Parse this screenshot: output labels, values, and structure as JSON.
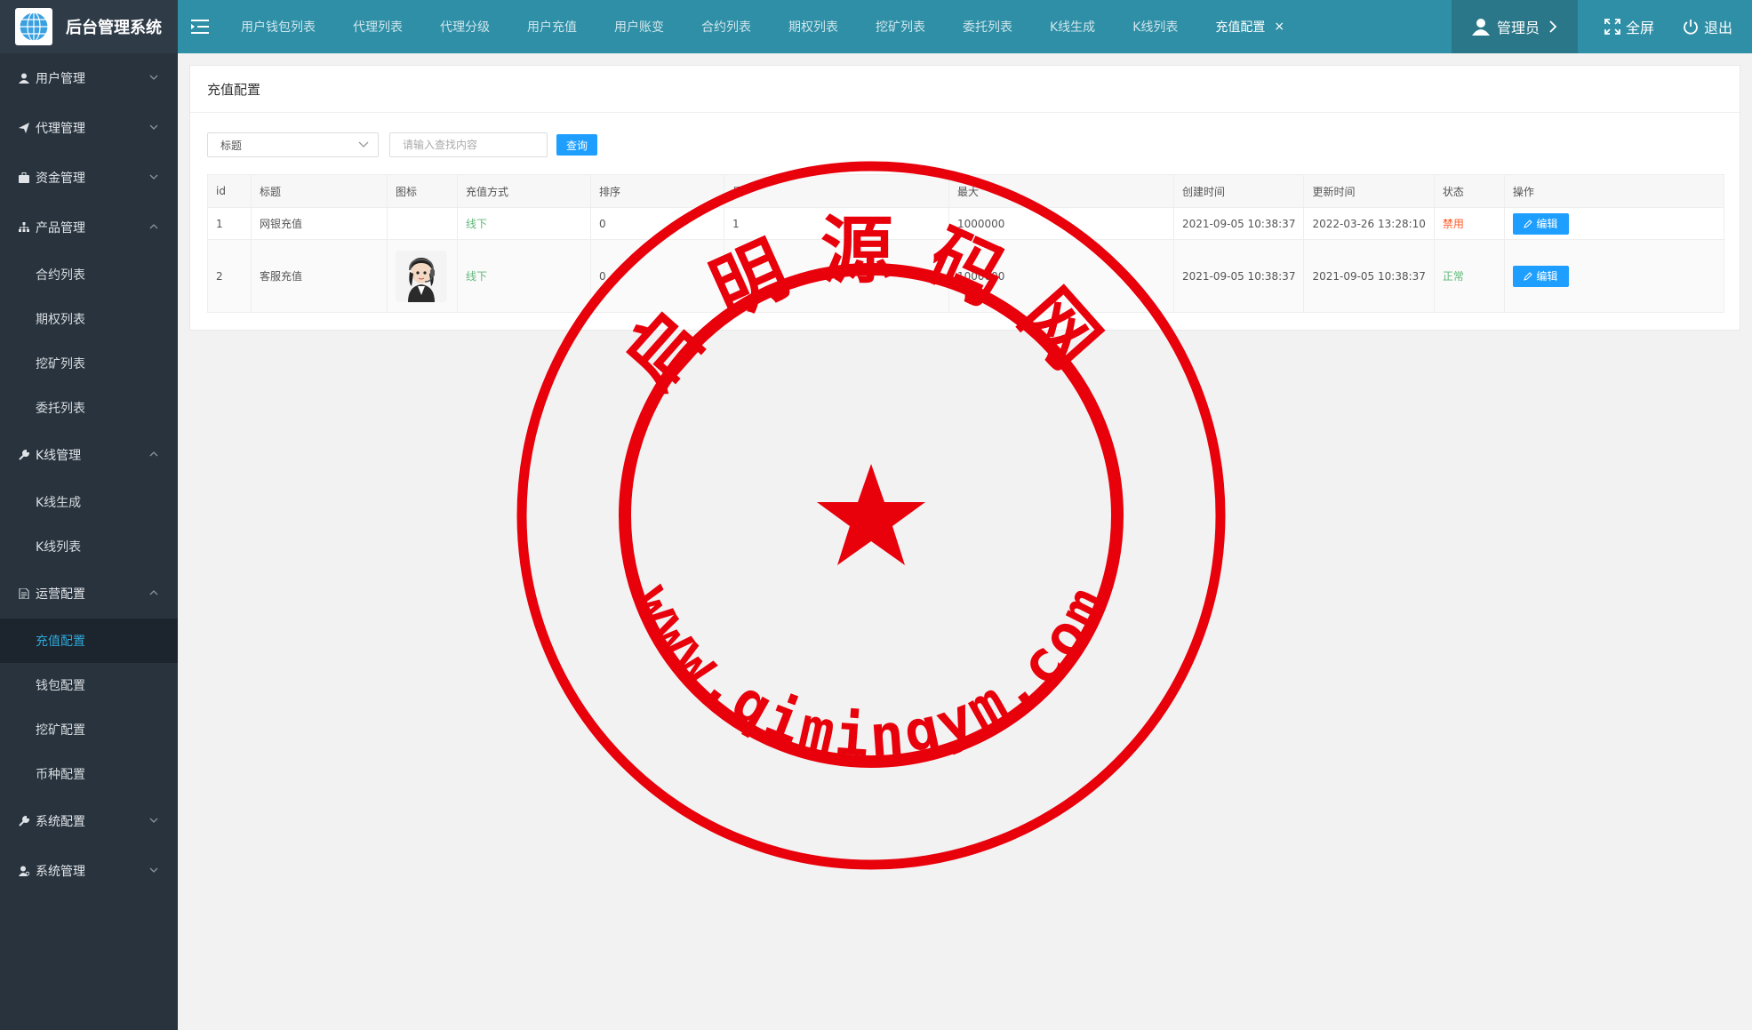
{
  "app": {
    "title": "后台管理系统",
    "logo_icon": "globe-icon"
  },
  "sidebar": {
    "groups": [
      {
        "label": "用户管理",
        "icon": "user-icon",
        "expanded": false
      },
      {
        "label": "代理管理",
        "icon": "paper-plane-icon",
        "expanded": false
      },
      {
        "label": "资金管理",
        "icon": "briefcase-icon",
        "expanded": false
      },
      {
        "label": "产品管理",
        "icon": "sitemap-icon",
        "expanded": true,
        "items": [
          "合约列表",
          "期权列表",
          "挖矿列表",
          "委托列表"
        ]
      },
      {
        "label": "K线管理",
        "icon": "wrench-icon",
        "expanded": true,
        "items": [
          "K线生成",
          "K线列表"
        ]
      },
      {
        "label": "运营配置",
        "icon": "document-icon",
        "expanded": true,
        "items": [
          "充值配置",
          "钱包配置",
          "挖矿配置",
          "币种配置"
        ],
        "active_item": "充值配置"
      },
      {
        "label": "系统配置",
        "icon": "wrench-icon",
        "expanded": false
      },
      {
        "label": "系统管理",
        "icon": "user-gear-icon",
        "expanded": false
      }
    ]
  },
  "topbar": {
    "tabs": [
      "用户钱包列表",
      "代理列表",
      "代理分级",
      "用户充值",
      "用户账变",
      "合约列表",
      "期权列表",
      "挖矿列表",
      "委托列表",
      "K线生成",
      "K线列表",
      "充值配置"
    ],
    "active_tab": "充值配置",
    "close_symbol": "×",
    "admin_label": "管理员",
    "fullscreen_label": "全屏",
    "logout_label": "退出"
  },
  "page": {
    "title": "充值配置",
    "filter": {
      "select_value": "标题",
      "input_placeholder": "请输入查找内容",
      "search_label": "查询"
    },
    "table": {
      "columns": [
        "id",
        "标题",
        "图标",
        "充值方式",
        "排序",
        "最",
        "最大",
        "创建时间",
        "更新时间",
        "状态",
        "操作"
      ],
      "rows": [
        {
          "id": "1",
          "title": "网银充值",
          "icon": "",
          "method": "线下",
          "sort": "0",
          "min": "1",
          "max": "1000000",
          "created": "2021-09-05 10:38:37",
          "updated": "2022-03-26 13:28:10",
          "status": "禁用",
          "action": "编辑"
        },
        {
          "id": "2",
          "title": "客服充值",
          "icon": "headset-avatar",
          "method": "线下",
          "sort": "0",
          "min": "",
          "max": "1000000",
          "created": "2021-09-05 10:38:37",
          "updated": "2021-09-05 10:38:37",
          "status": "正常",
          "action": "编辑"
        }
      ]
    }
  },
  "watermark": {
    "text_top": "启明源码网",
    "text_bottom": "www.qimingym.com",
    "color": "#e8000b"
  },
  "colors": {
    "sidebar_bg": "#28333e",
    "topbar_bg": "#2e8fa6",
    "primary_button": "#1e9fff",
    "active_menu_text": "#2fa7d8",
    "status_ok": "#5fb878",
    "status_disabled": "#ff5722"
  }
}
